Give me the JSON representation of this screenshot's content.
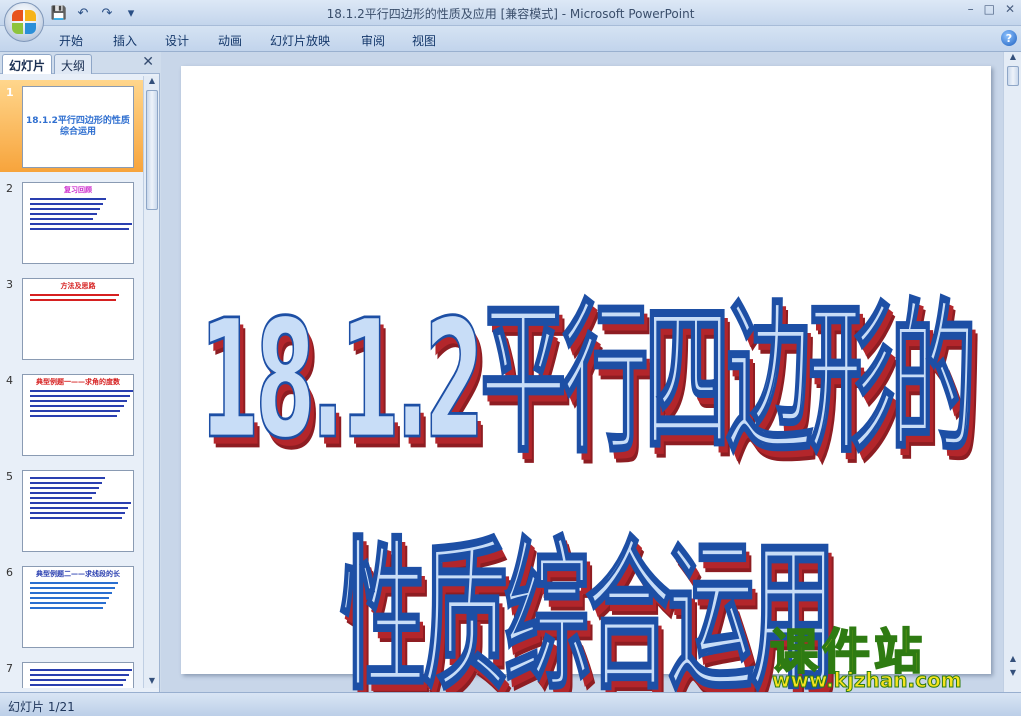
{
  "window": {
    "title": "18.1.2平行四边形的性质及应用 [兼容模式] - Microsoft PowerPoint",
    "controls": [
      "–",
      "□",
      "✕"
    ]
  },
  "quick_access": [
    {
      "name": "save-icon",
      "glyph": "💾"
    },
    {
      "name": "undo-icon",
      "glyph": "↶"
    },
    {
      "name": "redo-icon",
      "glyph": "↷"
    },
    {
      "name": "customize-icon",
      "glyph": "▾"
    }
  ],
  "ribbon": {
    "tabs": [
      "开始",
      "插入",
      "设计",
      "动画",
      "幻灯片放映",
      "审阅",
      "视图"
    ],
    "help": "?"
  },
  "panel": {
    "tabs": [
      "幻灯片",
      "大纲"
    ],
    "active_tab": "幻灯片",
    "close": "✕",
    "thumbnails": [
      {
        "num": "1",
        "title": "18.1.2平行四边形的性质综合运用",
        "title_color": "#2f6fd0",
        "lines": 0,
        "line_color": "#2f6fd0"
      },
      {
        "num": "2",
        "title": "复习回顾",
        "title_color": "#cc2ccc",
        "lines": 7,
        "line_color": "#2a3fb0"
      },
      {
        "num": "3",
        "title": "方法及思路",
        "title_color": "#d62020",
        "lines": 2,
        "line_color": "#d62020"
      },
      {
        "num": "4",
        "title": "典型例题一——求角的度数",
        "title_color": "#d62020",
        "lines": 6,
        "line_color": "#2a3fb0"
      },
      {
        "num": "5",
        "title": "",
        "title_color": "#2a3fb0",
        "lines": 9,
        "line_color": "#2a3fb0"
      },
      {
        "num": "6",
        "title": "典型例题二——求线段的长",
        "title_color": "#2a3fb0",
        "lines": 6,
        "line_color": "#2a6fd0"
      },
      {
        "num": "7",
        "title": "",
        "title_color": "#2a3fb0",
        "lines": 5,
        "line_color": "#2a3fb0"
      }
    ]
  },
  "slide": {
    "title": "18.1.2平行四边形的性质综合运用"
  },
  "watermark": {
    "cn": "课件站",
    "url": "www.kjzhan.com"
  },
  "status": {
    "slide_indicator": "幻灯片 1/21"
  }
}
